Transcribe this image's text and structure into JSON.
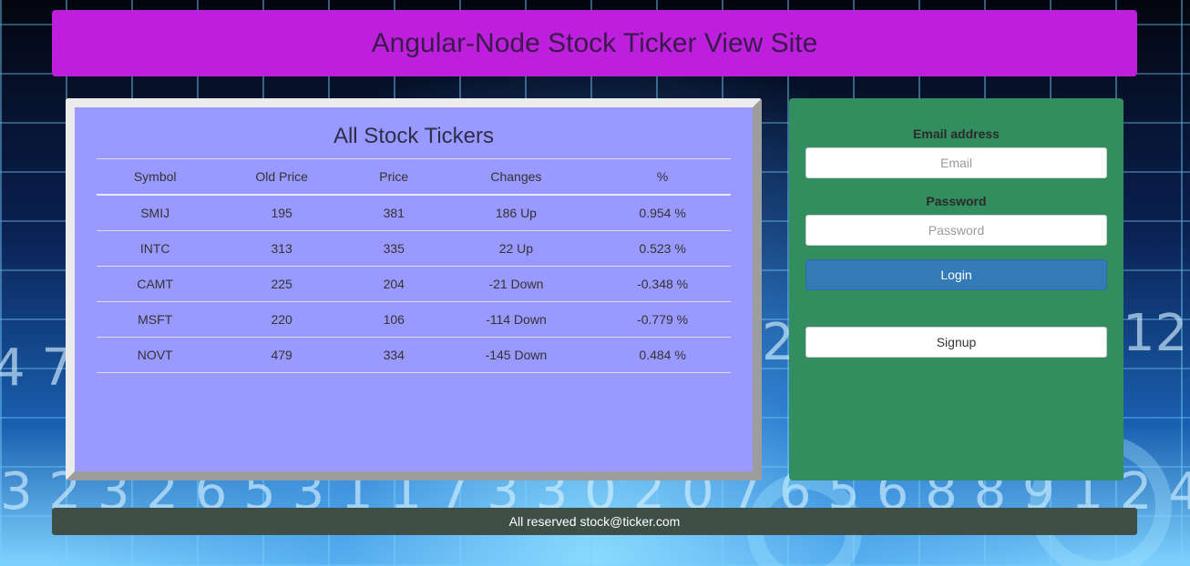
{
  "header": {
    "title": "Angular-Node Stock Ticker View Site"
  },
  "tickers": {
    "title": "All Stock Tickers",
    "columns": [
      "Symbol",
      "Old Price",
      "Price",
      "Changes",
      "%"
    ],
    "rows": [
      [
        "SMIJ",
        "195",
        "381",
        "186 Up",
        "0.954 %"
      ],
      [
        "INTC",
        "313",
        "335",
        "22 Up",
        "0.523 %"
      ],
      [
        "CAMT",
        "225",
        "204",
        "-21 Down",
        "-0.348 %"
      ],
      [
        "MSFT",
        "220",
        "106",
        "-114 Down",
        "-0.779 %"
      ],
      [
        "NOVT",
        "479",
        "334",
        "-145 Down",
        "0.484 %"
      ]
    ]
  },
  "login": {
    "email_label": "Email address",
    "email_placeholder": "Email",
    "password_label": "Password",
    "password_placeholder": "Password",
    "login_button": "Login",
    "signup_button": "Signup"
  },
  "footer": {
    "text": "All reserved stock@ticker.com"
  },
  "colors": {
    "header_bg": "#bd1fdc",
    "ticker_panel_bg": "#9999ff",
    "login_panel_bg": "#338e5f",
    "login_button_bg": "#337ab7",
    "footer_bg": "#3f4f47"
  }
}
